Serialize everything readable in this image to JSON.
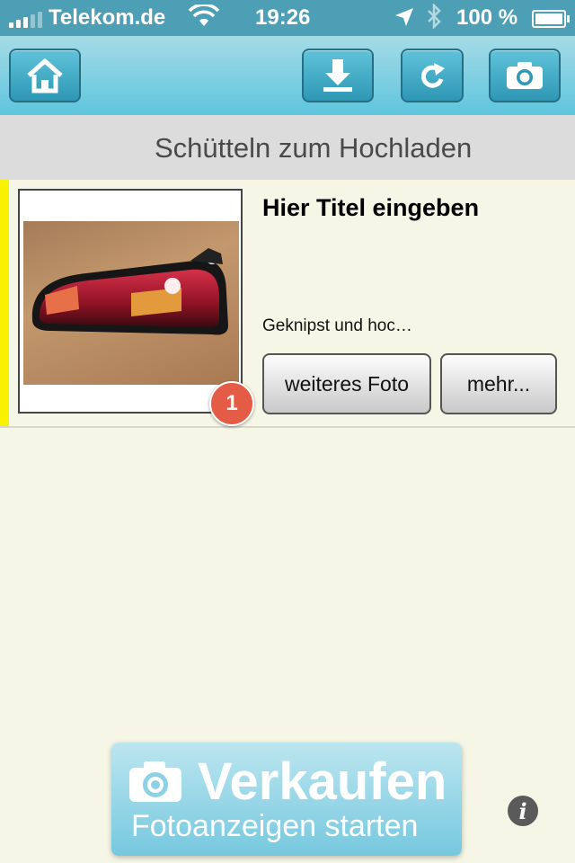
{
  "status": {
    "carrier": "Telekom.de",
    "time": "19:26",
    "battery": "100 %"
  },
  "toolbar": {
    "home_icon": "home-icon",
    "download_icon": "download-icon",
    "refresh_icon": "refresh-icon",
    "camera_icon": "camera-icon"
  },
  "subheader": "Schütteln zum Hochladen",
  "item": {
    "title": "Hier Titel eingeben",
    "subtitle": "Geknipst und hoc…",
    "photo_count": "1",
    "more_photo_label": "weiteres Foto",
    "more_label": "mehr...",
    "stripe_color": "#f8f200"
  },
  "sell_button": {
    "title": "Verkaufen",
    "subtitle": "Fotoanzeigen starten"
  },
  "info_label": "i",
  "colors": {
    "toolbar": "#5ec5dd",
    "badge": "#e45c46",
    "background": "#f6f6e6"
  }
}
